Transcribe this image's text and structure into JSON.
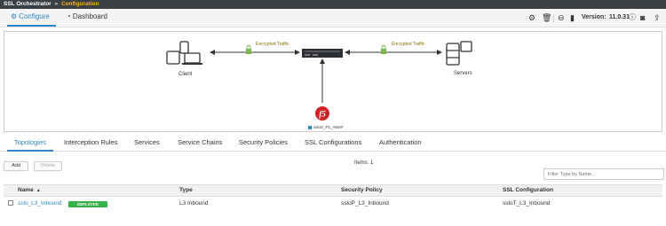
{
  "breadcrumb": {
    "app": "SSL Orchestrator",
    "separator": "»",
    "current": "Configuration"
  },
  "nav": {
    "tabs": [
      {
        "label": "Configure",
        "icon": "gear-icon",
        "active": true
      },
      {
        "label": "Dashboard",
        "icon": "gauge-icon",
        "active": false
      }
    ],
    "version_label": "Version:",
    "version": "11.0.31"
  },
  "diagram": {
    "client_label": "Client",
    "servers_label": "Servers",
    "left_traffic_label": "Encrypted Traffic",
    "right_traffic_label": "Encrypted Traffic",
    "f5_label": "ssloS_F5_AWAF"
  },
  "tabs": [
    {
      "label": "Topologies",
      "active": true
    },
    {
      "label": "Interception Rules",
      "active": false
    },
    {
      "label": "Services",
      "active": false
    },
    {
      "label": "Service Chains",
      "active": false
    },
    {
      "label": "Security Policies",
      "active": false
    },
    {
      "label": "SSL Configurations",
      "active": false
    },
    {
      "label": "Authentication",
      "active": false
    }
  ],
  "toolbar": {
    "add_label": "Add",
    "delete_label": "Delete",
    "items_text": "Items: 1",
    "filter_placeholder": "Filter Type by Name..."
  },
  "table": {
    "columns": [
      "Name",
      "Type",
      "Security Policy",
      "SSL Configuration"
    ],
    "rows": [
      {
        "name": "sslo_L3_Inbound",
        "status": "DEPLOYED",
        "type": "L3 Inbound",
        "security_policy": "ssloP_L3_Inbound",
        "ssl_configuration": "ssloT_L3_Inbound"
      }
    ]
  },
  "colors": {
    "accent": "#2f86c8",
    "deployed": "#38b24a",
    "f5": "#d2232a",
    "lock": "#7ab648"
  }
}
